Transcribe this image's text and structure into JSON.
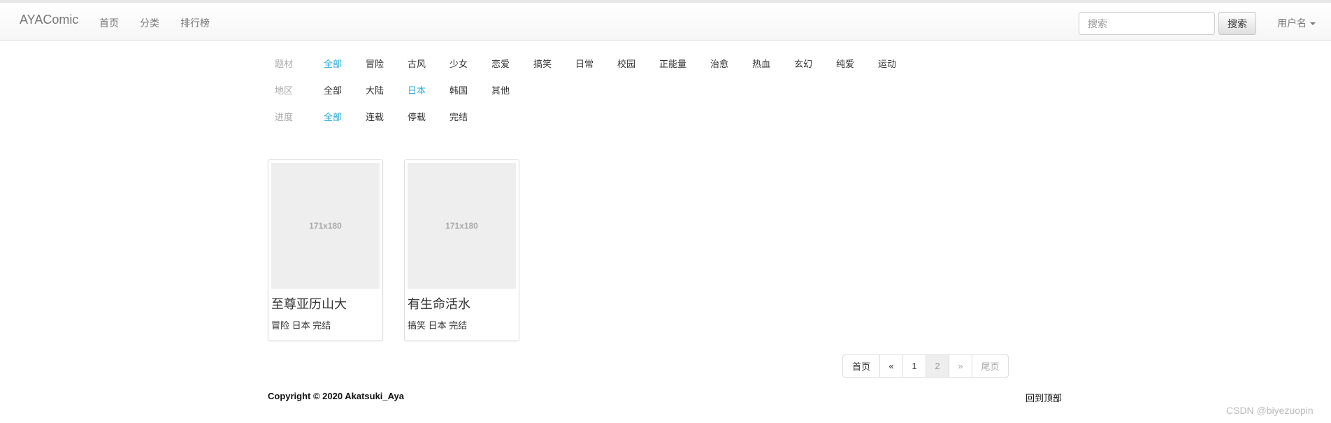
{
  "navbar": {
    "brand": "AYAComic",
    "links": [
      "首页",
      "分类",
      "排行榜"
    ],
    "search_placeholder": "搜索",
    "search_button": "搜索",
    "user_menu": "用户名"
  },
  "filters": {
    "genre": {
      "label": "题材",
      "options": [
        "全部",
        "冒险",
        "古风",
        "少女",
        "恋爱",
        "搞笑",
        "日常",
        "校园",
        "正能量",
        "治愈",
        "热血",
        "玄幻",
        "纯爱",
        "运动"
      ],
      "selected": "全部"
    },
    "region": {
      "label": "地区",
      "options": [
        "全部",
        "大陆",
        "日本",
        "韩国",
        "其他"
      ],
      "selected": "日本"
    },
    "progress": {
      "label": "进度",
      "options": [
        "全部",
        "连载",
        "停载",
        "完结"
      ],
      "selected": "全部"
    },
    "active_color": "#2dabd9"
  },
  "comics": [
    {
      "thumb_text": "171x180",
      "title": "至尊亚历山大",
      "tags": "冒险 日本 完结"
    },
    {
      "thumb_text": "171x180",
      "title": "有生命活水",
      "tags": "搞笑 日本 完结"
    }
  ],
  "pagination": {
    "first": "首页",
    "prev": "«",
    "pages": [
      "1",
      "2"
    ],
    "current": "2",
    "next": "»",
    "last": "尾页"
  },
  "footer": {
    "copyright": "Copyright © 2020 Akatsuki_Aya",
    "back_to_top": "回到顶部"
  },
  "watermark": "CSDN @biyezuopin"
}
